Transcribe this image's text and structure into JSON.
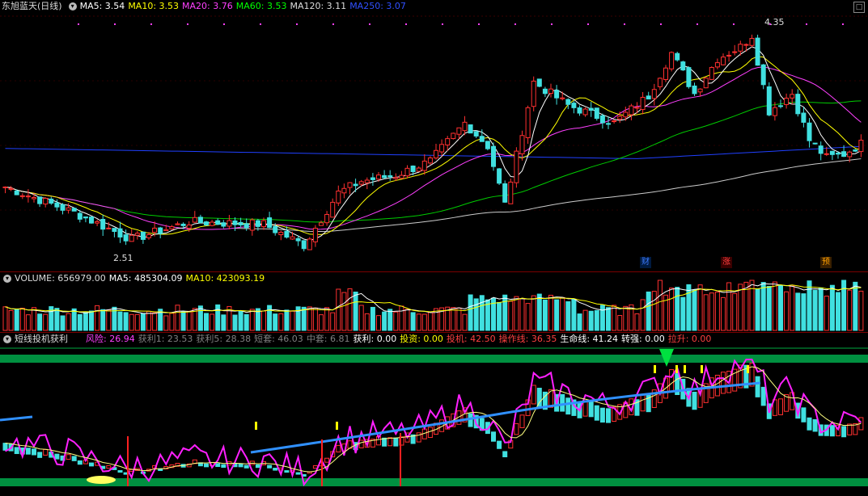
{
  "main": {
    "title": "东旭蓝天(日线)",
    "indicators": [
      {
        "label": "MA5: 3.54",
        "color": "#ffffff"
      },
      {
        "label": "MA10: 3.53",
        "color": "#ffff00"
      },
      {
        "label": "MA20: 3.76",
        "color": "#ff40ff"
      },
      {
        "label": "MA60: 3.53",
        "color": "#00ff00"
      },
      {
        "label": "MA120: 3.11",
        "color": "#dddddd"
      },
      {
        "label": "MA250: 3.07",
        "color": "#3050ff"
      }
    ],
    "high_label": "4.35",
    "low_label": "2.51",
    "badges": [
      {
        "text": "财",
        "color": "#3c7bff"
      },
      {
        "text": "涨",
        "color": "#ff4040"
      },
      {
        "text": "预",
        "color": "#ffa000"
      }
    ]
  },
  "volume": {
    "title": "VOLUME: 656979.00",
    "indicators": [
      {
        "label": "MA5: 485304.09",
        "color": "#ffffff"
      },
      {
        "label": "MA10: 423093.19",
        "color": "#ffff00"
      }
    ]
  },
  "indicator": {
    "title": "短线投机获利",
    "items": [
      {
        "label": "风险: 26.94",
        "color": "#ff40ff"
      },
      {
        "label": "获利1: 23.53",
        "color": "#808080"
      },
      {
        "label": "获利5: 28.38",
        "color": "#808080"
      },
      {
        "label": "短套: 46.03",
        "color": "#808080"
      },
      {
        "label": "中套: 6.81",
        "color": "#808080"
      },
      {
        "label": "获利: 0.00",
        "color": "#ffffff"
      },
      {
        "label": "投资: 0.00",
        "color": "#ffff00"
      },
      {
        "label": "投机: 42.50",
        "color": "#ff4040"
      },
      {
        "label": "操作线: 36.35",
        "color": "#ff4040"
      },
      {
        "label": "生命线: 41.24",
        "color": "#ffffff"
      },
      {
        "label": "转强: 0.00",
        "color": "#ffffff"
      },
      {
        "label": "拉升: 0.00",
        "color": "#ff4040"
      }
    ]
  }
}
